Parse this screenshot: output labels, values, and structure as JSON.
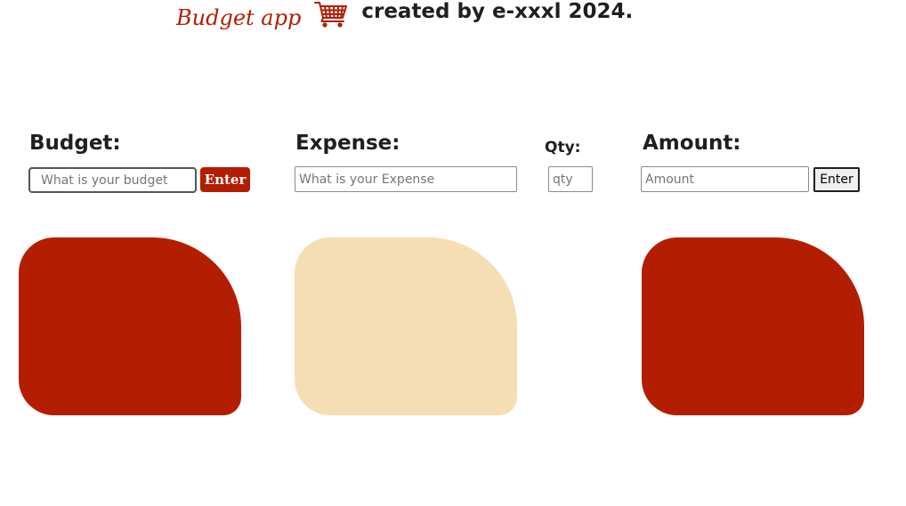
{
  "header": {
    "app_title": "Budget app",
    "cart_icon": "shopping-cart-icon",
    "credit": "created by e-xxxl 2024."
  },
  "budget": {
    "label": "Budget:",
    "placeholder": "What is your budget",
    "value": "",
    "enter_label": "Enter"
  },
  "expense": {
    "label": "Expense:",
    "placeholder": "What is your Expense",
    "value": ""
  },
  "qty": {
    "label": "Qty:",
    "placeholder": "qty",
    "value": ""
  },
  "amount": {
    "label": "Amount:",
    "placeholder": "Amount",
    "value": "",
    "enter_label": "Enter"
  },
  "cards": {
    "budget_color": "#b31d00",
    "expense_color": "#f5deb3",
    "amount_color": "#b31d00"
  }
}
